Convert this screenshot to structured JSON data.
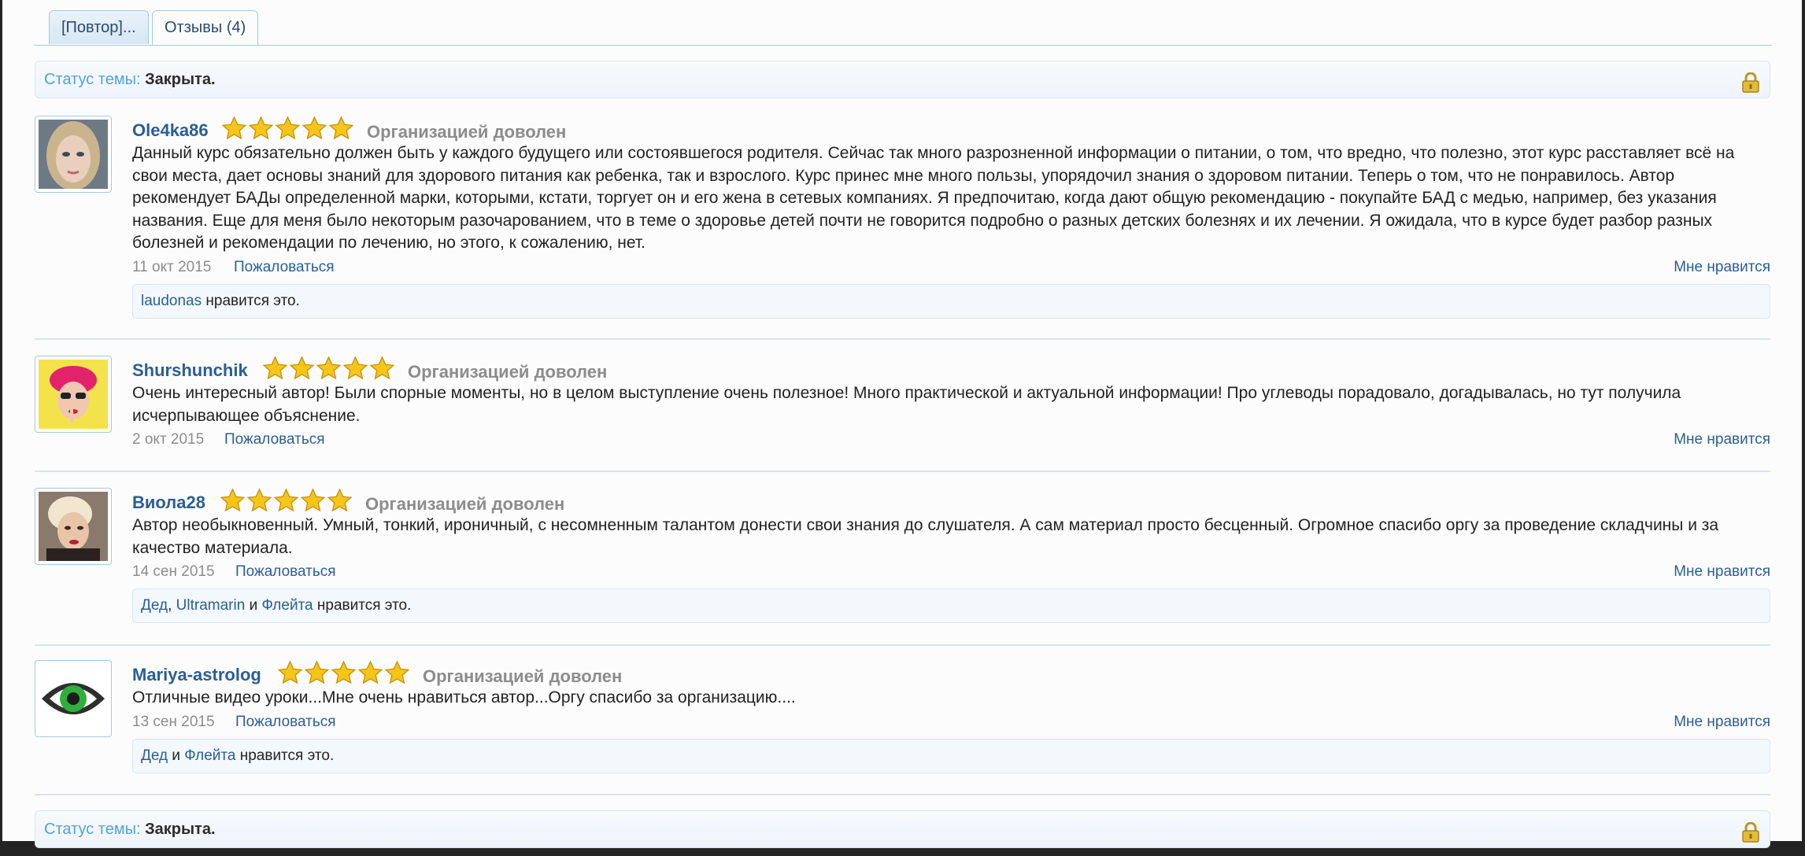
{
  "tabs": [
    {
      "label": "[Повтор]..."
    },
    {
      "label": "Отзывы (4)"
    }
  ],
  "status": {
    "label": "Статус темы:",
    "value": "Закрыта."
  },
  "posts": [
    {
      "username": "Ole4ka86",
      "rating_stars": 5,
      "rating_text": "Организацией доволен",
      "text": "Данный курс обязательно должен быть у каждого будущего или состоявшегося родителя. Сейчас так много разрозненной информации о питании, о том, что вредно, что полезно, этот курс расставляет всё на свои места, дает основы знаний для здорового питания как ребенка, так и взрослого. Курс принес мне много пользы, упорядочил знания о здоровом питании. Теперь о том, что не понравилось. Автор рекомендует БАДы определенной марки, которыми, кстати, торгует он и его жена в сетевых компаниях. Я предпочитаю, когда дают общую рекомендацию - покупайте БАД с медью, например, без указания названия. Еще для меня было некоторым разочарованием, что в теме о здоровье детей почти не говорится подробно о разных детских болезнях и их лечении. Я ожидала, что в курсе будет разбор разных болезней и рекомендации по лечению, но этого, к сожалению, нет.",
      "date": "11 окт 2015",
      "report": "Пожаловаться",
      "like": "Мне нравится",
      "likes": {
        "users": [
          "laudonas"
        ],
        "suffix": "нравится это."
      }
    },
    {
      "username": "Shurshunchik",
      "rating_stars": 5,
      "rating_text": "Организацией доволен",
      "text": "Очень интересный автор! Были спорные моменты, но в целом выступление очень полезное! Много практической и актуальной информации! Про углеводы порадовало, догадывалась, но тут получила исчерпывающее объяснение.",
      "date": "2 окт 2015",
      "report": "Пожаловаться",
      "like": "Мне нравится"
    },
    {
      "username": "Виола28",
      "rating_stars": 5,
      "rating_text": "Организацией доволен",
      "text": "Автор необыкновенный. Умный, тонкий, ироничный, с несомненным талантом донести свои знания до слушателя. А сам материал просто бесценный. Огромное спасибо оргу за проведение складчины и за качество материала.",
      "date": "14 сен 2015",
      "report": "Пожаловаться",
      "like": "Мне нравится",
      "likes": {
        "users": [
          "Дед",
          "Ultramarin",
          "Флейта"
        ],
        "sep1": ",",
        "and": "и",
        "suffix": "нравится это."
      }
    },
    {
      "username": "Mariya-astrolog",
      "rating_stars": 5,
      "rating_text": "Организацией доволен",
      "text": "Отличные видео уроки...Мне очень нравиться автор...Оргу спасибо за организацию....",
      "date": "13 сен 2015",
      "report": "Пожаловаться",
      "like": "Мне нравится",
      "likes": {
        "users": [
          "Дед",
          "Флейта"
        ],
        "and": "и",
        "suffix": "нравится это."
      }
    }
  ],
  "colors": {
    "link": "#2b5e94",
    "status_label": "#52a2da",
    "muted": "#8c8c8c",
    "border": "#a5cae4",
    "star": "#f5c518"
  },
  "icons": {
    "lock": "lock-icon",
    "star": "star-icon"
  }
}
